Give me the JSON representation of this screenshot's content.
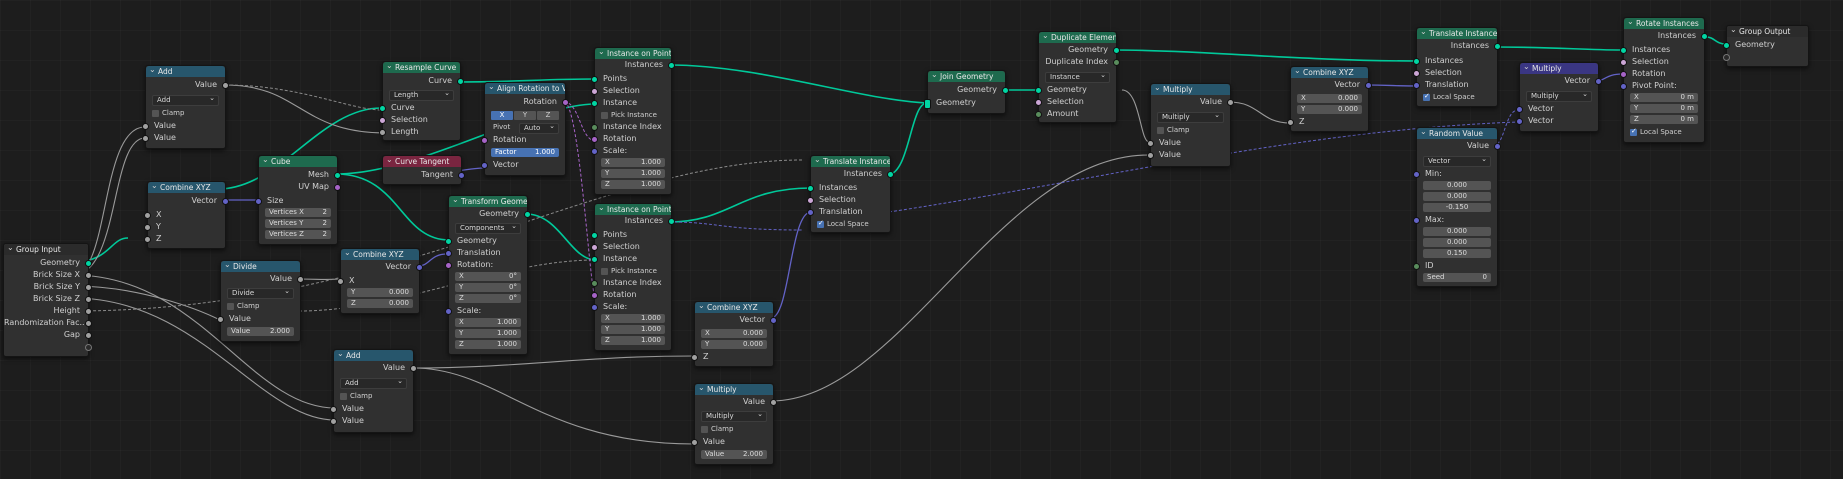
{
  "labels": {
    "geometry": "Geometry",
    "value": "Value",
    "vector": "Vector",
    "x": "X",
    "y": "Y",
    "z": "Z",
    "clamp": "Clamp",
    "instances": "Instances",
    "points": "Points",
    "instance": "Instance",
    "selection": "Selection",
    "pick_instance": "Pick Instance",
    "instance_index": "Instance Index",
    "rotation": "Rotation",
    "scale": "Scale:",
    "rotation_colon": "Rotation:",
    "translation": "Translation",
    "local_space": "Local Space",
    "curve": "Curve",
    "length": "Length",
    "mesh": "Mesh",
    "uv_map": "UV Map",
    "size": "Size",
    "tangent": "Tangent",
    "pivot": "Pivot",
    "factor": "Factor",
    "amount": "Amount",
    "duplicate_index": "Duplicate Index",
    "min": "Min:",
    "max": "Max:",
    "id": "ID",
    "seed": "Seed",
    "pivot_point": "Pivot Point:",
    "verts_x": "Vertices X",
    "verts_y": "Vertices Y",
    "verts_z": "Vertices Z"
  },
  "nodes": {
    "group_input": {
      "title": "Group Input",
      "outputs": [
        "Geometry",
        "Brick Size X",
        "Brick Size Y",
        "Brick Size Z",
        "Height",
        "Randomization Fac...",
        "Gap"
      ]
    },
    "add_top": {
      "title": "Add",
      "operation": "Add"
    },
    "combine_xyz_1": {
      "title": "Combine XYZ"
    },
    "resample_curve": {
      "title": "Resample Curve",
      "mode": "Length"
    },
    "cube": {
      "title": "Cube",
      "vx": "2",
      "vy": "2",
      "vz": "2"
    },
    "curve_tangent": {
      "title": "Curve Tangent"
    },
    "align_rotation": {
      "title": "Align Rotation to V...",
      "axis_x": "X",
      "axis_y": "Y",
      "axis_z": "Z",
      "pivot_value": "Auto",
      "factor_value": "1.000"
    },
    "instance_on_points_1": {
      "title": "Instance on Points",
      "sx": "1.000",
      "sy": "1.000",
      "sz": "1.000"
    },
    "transform_geometry": {
      "title": "Transform Geometry",
      "mode": "Components",
      "rx": "0°",
      "ry": "0°",
      "rz": "0°",
      "sx": "1.000",
      "sy": "1.000",
      "sz": "1.000"
    },
    "instance_on_points_2": {
      "title": "Instance on Points",
      "sx": "1.000",
      "sy": "1.000",
      "sz": "1.000"
    },
    "divide": {
      "title": "Divide",
      "operation": "Divide",
      "value2": "2.000"
    },
    "combine_xyz_2": {
      "title": "Combine XYZ",
      "y": "0.000",
      "z": "0.000"
    },
    "add_bottom": {
      "title": "Add",
      "operation": "Add"
    },
    "combine_xyz_3": {
      "title": "Combine XYZ",
      "x": "0.000",
      "y": "0.000"
    },
    "multiply_bottom": {
      "title": "Multiply",
      "operation": "Multiply",
      "value2": "2.000"
    },
    "translate_instances_1": {
      "title": "Translate Instances"
    },
    "join_geometry": {
      "title": "Join Geometry"
    },
    "duplicate_elements": {
      "title": "Duplicate Elements",
      "domain": "Instance"
    },
    "multiply_mid": {
      "title": "Multiply",
      "operation": "Multiply"
    },
    "combine_xyz_4": {
      "title": "Combine XYZ",
      "x": "0.000",
      "y": "0.000"
    },
    "translate_instances_2": {
      "title": "Translate Instances"
    },
    "random_value": {
      "title": "Random Value",
      "type": "Vector",
      "min": [
        "0.000",
        "0.000",
        "-0.150"
      ],
      "max": [
        "0.000",
        "0.000",
        "0.150"
      ],
      "seed": "0"
    },
    "multiply_vec": {
      "title": "Multiply",
      "operation": "Multiply"
    },
    "rotate_instances": {
      "title": "Rotate Instances",
      "px": "0 m",
      "py": "0 m",
      "pz": "0 m"
    },
    "group_output": {
      "title": "Group Output"
    }
  },
  "colors": {
    "geometry_socket": "#00d6a3",
    "float_socket": "#a1a1a1",
    "vector_socket": "#6363c7",
    "rotation_socket": "#a663c7",
    "accent": "#4772b3"
  }
}
